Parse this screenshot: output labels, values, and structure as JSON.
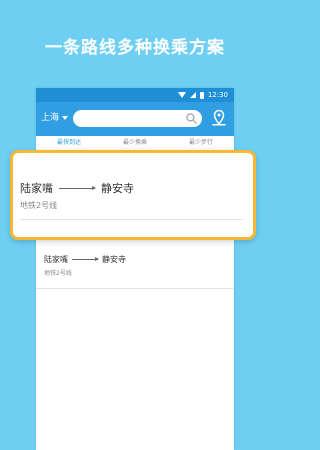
{
  "banner": {
    "title": "一条路线多种换乘方案"
  },
  "status_bar": {
    "time": "12:30"
  },
  "app_bar": {
    "city": "上海",
    "search": {
      "value": "",
      "placeholder": ""
    },
    "icons": {
      "search": "search-icon",
      "map": "map-pin-icon"
    }
  },
  "tabs": [
    {
      "label": "最快到达"
    },
    {
      "label": "最少换乘"
    },
    {
      "label": "最少步行"
    }
  ],
  "routes": [
    {
      "from": "陆家嘴",
      "to": "静安寺",
      "line": "地铁2号线"
    },
    {
      "from": "陆家嘴",
      "to": "静安寺",
      "line": "地铁2号线"
    }
  ],
  "colors": {
    "background": "#6ecff3",
    "app_bar": "#2f9ee2",
    "status_bar": "#1e8fd6",
    "highlight_border": "#f5b833"
  }
}
